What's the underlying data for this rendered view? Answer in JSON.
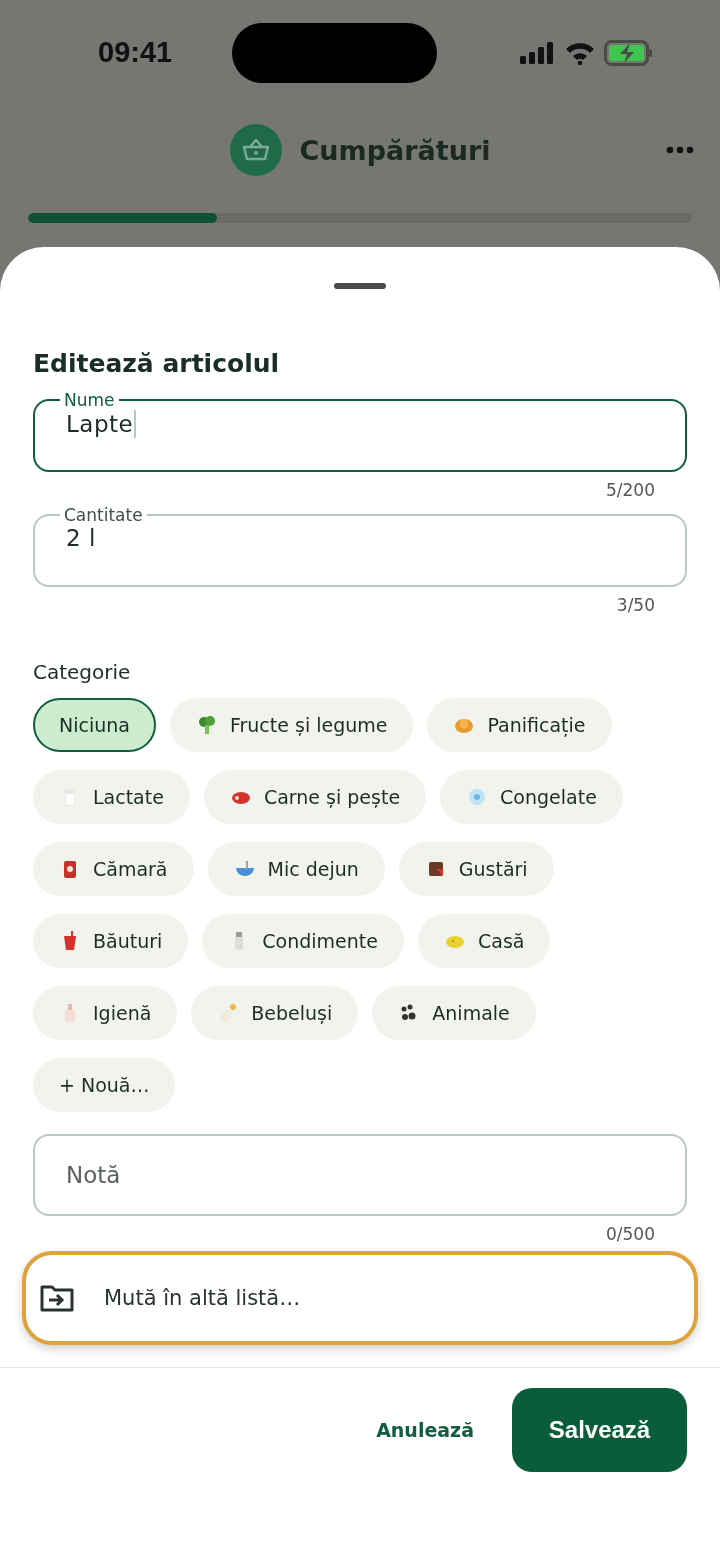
{
  "status_bar": {
    "time": "09:41"
  },
  "header": {
    "title": "Cumpărături",
    "progress": {
      "level": 0.285
    }
  },
  "sheet": {
    "title": "Editează articolul",
    "fields": [
      {
        "label": "Nume",
        "value": "Lapte",
        "counter": "5/200",
        "focused": true
      },
      {
        "label": "Cantitate",
        "value": "2 l",
        "counter": "3/50",
        "focused": false
      }
    ],
    "category": {
      "label": "Categorie",
      "chips": [
        {
          "label": "Niciuna",
          "selected": true
        },
        {
          "label": "Fructe și legume",
          "selected": false
        },
        {
          "label": "Panificație",
          "selected": false
        },
        {
          "label": "Lactate",
          "selected": false
        },
        {
          "label": "Carne și pește",
          "selected": false
        },
        {
          "label": "Congelate",
          "selected": false
        },
        {
          "label": "Cămară",
          "selected": false
        },
        {
          "label": "Mic dejun",
          "selected": false
        },
        {
          "label": "Gustări",
          "selected": false
        },
        {
          "label": "Băuturi",
          "selected": false
        },
        {
          "label": "Condimente",
          "selected": false
        },
        {
          "label": "Casă",
          "selected": false
        },
        {
          "label": "Igienă",
          "selected": false
        },
        {
          "label": "Bebeluși",
          "selected": false
        },
        {
          "label": "Animale",
          "selected": false
        }
      ],
      "new_chip": "+ Nouă…"
    },
    "note": {
      "placeholder": "Notă",
      "counter": "0/500"
    },
    "move_button": {
      "label": "Mută în altă listă…"
    },
    "buttons": {
      "cancel": "Anulează",
      "save": "Salvează"
    }
  }
}
